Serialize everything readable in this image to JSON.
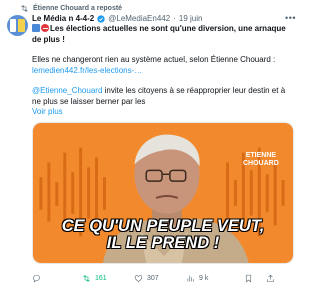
{
  "repost": {
    "text": "Étienne Chouard a reposté"
  },
  "author": {
    "name": "Le Média n 4-4-2",
    "handle": "@LeMediaEn442",
    "separator": "·",
    "date": "19 juin"
  },
  "post": {
    "headline": "Les élections actuelles ne sont qu'une diversion, une arnaque de plus !",
    "line2": "Elles ne changeront rien au système actuel, selon Étienne Chouard :",
    "link": "lemedien442.fr/les-elections-…",
    "mention": "@Etienne_Chouard",
    "line3_rest": " invite les citoyens à se réapproprier leur destin et à ne plus se laisser berner par les",
    "see_more": "Voir plus"
  },
  "media": {
    "name_line1": "ETIENNE",
    "name_line2": "CHOUARD",
    "caption_line1": "CE QU'UN PEUPLE VEUT,",
    "caption_line2": "IL LE PREND !"
  },
  "actions": {
    "replies": "",
    "reposts": "161",
    "likes": "307",
    "views": "9 k"
  },
  "icons": {
    "repost": "repost-icon",
    "reply": "reply-icon",
    "like": "heart-icon",
    "views": "views-chart-icon",
    "bookmark": "bookmark-icon",
    "share": "share-icon"
  },
  "colors": {
    "accent": "#1d9bf0",
    "repost_active": "#00ba7c",
    "media_bg": "#f28a2d"
  }
}
